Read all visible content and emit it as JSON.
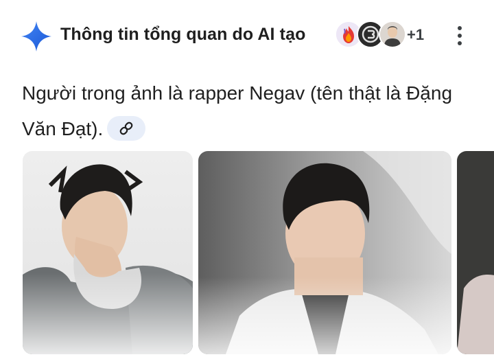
{
  "header": {
    "title": "Thông tin tổng quan do AI tạo",
    "sources_more": "+1",
    "icons": {
      "sparkle": "ai-sparkle-icon",
      "menu": "more-vert-icon",
      "link": "link-icon"
    },
    "colors": {
      "sparkle": "#1a73e8",
      "chip": "#e8eef9"
    }
  },
  "answer": {
    "text": "Người trong ảnh là rapper Negav (tên thật là Đặng Văn Đạt)."
  },
  "images": [
    {
      "name": "image-result-1"
    },
    {
      "name": "image-result-2"
    },
    {
      "name": "image-result-3"
    }
  ]
}
